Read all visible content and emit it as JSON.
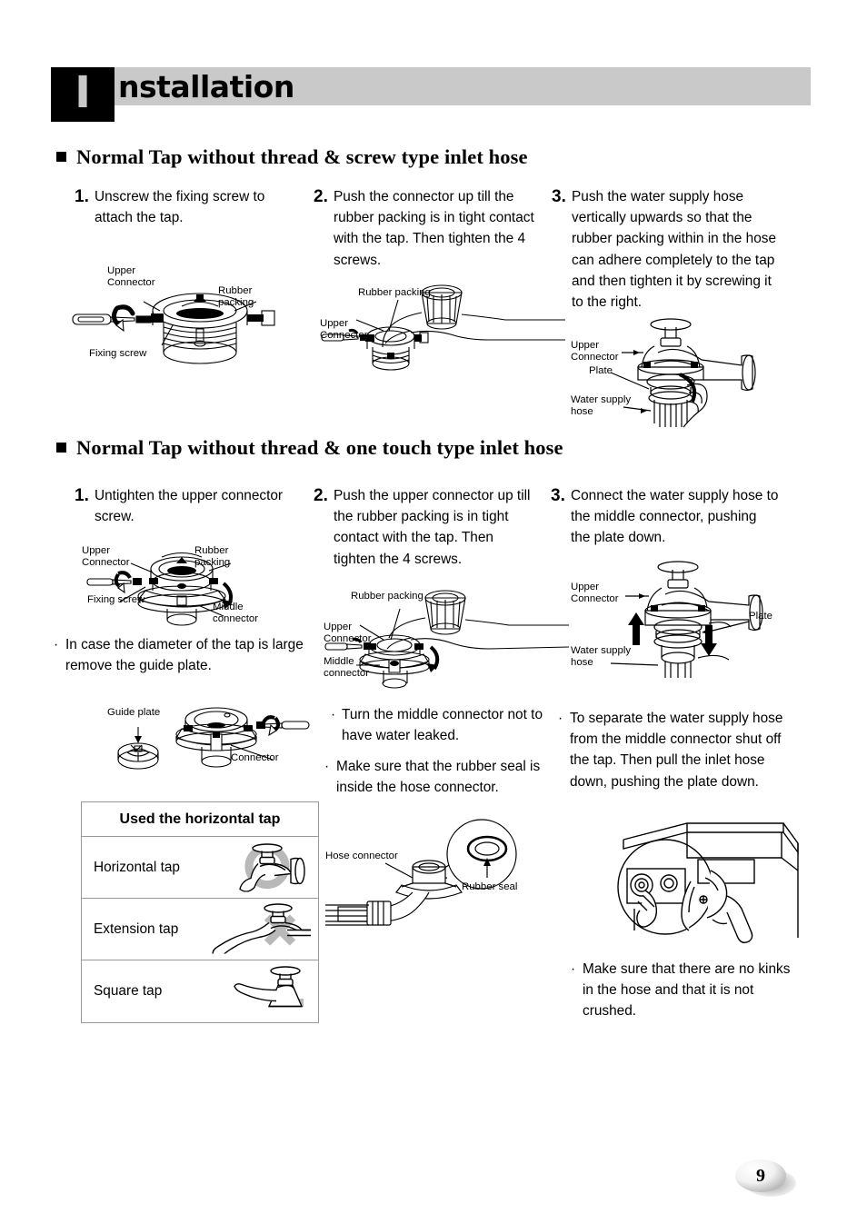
{
  "header": {
    "badge_letter": "I",
    "title": "nstallation",
    "bar_color": "#c9c9c9"
  },
  "sections": [
    {
      "heading": "Normal Tap without thread & screw type inlet hose",
      "steps": [
        {
          "number": "1.",
          "text": "Unscrew the fixing screw to attach the tap."
        },
        {
          "number": "2.",
          "text": "Push the connector up till the rubber packing is in tight contact with the tap. Then tighten the 4 screws."
        },
        {
          "number": "3.",
          "text": "Push the water supply hose vertically upwards so that the rubber packing within in the hose can adhere completely to the tap and then tighten it by screwing it to the right."
        }
      ],
      "figures": [
        {
          "name": "screw-type-upper-connector-figure",
          "labels": [
            "Upper\nConnector",
            "Rubber\npacking",
            "Fixing screw"
          ]
        },
        {
          "name": "screw-type-rubber-packing-figure",
          "labels": [
            "Rubber packing",
            "Upper\nConnector"
          ]
        },
        {
          "name": "screw-type-tap-hose-figure",
          "labels": [
            "Upper\nConnector",
            "Plate",
            "Water supply\nhose"
          ]
        }
      ]
    },
    {
      "heading": "Normal Tap without thread & one touch type inlet hose",
      "steps": [
        {
          "number": "1.",
          "text": "Untighten the upper connector screw."
        },
        {
          "number": "2.",
          "text": "Push the upper connector up till the rubber packing is in tight contact with the tap. Then tighten the 4 screws."
        },
        {
          "number": "3.",
          "text": "Connect the water supply hose to the middle connector, pushing the plate down."
        }
      ],
      "figures": [
        {
          "name": "one-touch-upper-connector-figure",
          "labels": [
            "Upper\nConnector",
            "Rubber\npacking",
            "Fixing screw",
            "Middle\nconnector"
          ]
        },
        {
          "name": "guide-plate-figure",
          "labels": [
            "Guide plate",
            "Connector"
          ]
        },
        {
          "name": "one-touch-rubber-packing-figure",
          "labels": [
            "Rubber packing",
            "Upper\nConnector",
            "Middle\nconnector"
          ]
        },
        {
          "name": "hose-connector-rubber-seal-figure",
          "labels": [
            "Hose connector",
            "Rubber seal"
          ]
        },
        {
          "name": "one-touch-tap-plate-figure",
          "labels": [
            "Upper\nConnector",
            "Plate",
            "Water supply\nhose"
          ]
        },
        {
          "name": "washing-machine-hose-figure",
          "labels": []
        }
      ]
    }
  ],
  "notes": {
    "guide_plate": "In case the diameter of the tap is large remove the guide plate.",
    "middle_connector": "Turn the middle connector not to have water leaked.",
    "rubber_seal": "Make sure that the rubber seal is inside the hose connector.",
    "separate_hose": "To separate the water supply hose from the middle connector shut off the tap. Then pull the inlet hose down, pushing the plate down.",
    "no_kinks": "Make sure that there are no kinks in the hose and that it is not crushed.",
    "bullet_glyph": "·"
  },
  "tap_table": {
    "header": "Used the horizontal tap",
    "rows": [
      {
        "label": "Horizontal tap",
        "icon": "horizontal-tap-icon"
      },
      {
        "label": "Extension tap",
        "icon": "extension-tap-icon"
      },
      {
        "label": "Square tap",
        "icon": "square-tap-icon"
      }
    ]
  },
  "page_number": "9"
}
